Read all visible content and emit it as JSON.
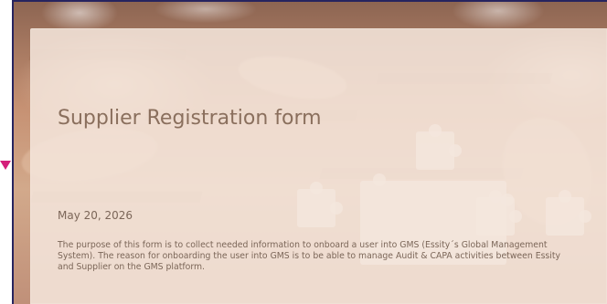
{
  "header": {
    "title": "Supplier Registration form"
  },
  "meta": {
    "date": "May 20, 2026"
  },
  "content": {
    "description": "The purpose of this form is to collect needed information to onboard a user into GMS (Essity´s Global Management System). The reason for onboarding the user into GMS is to be able to manage Audit & CAPA activities between Essity and Supplier on the GMS platform."
  },
  "theme": {
    "accent_border": "#27245f",
    "pointer_color": "#d41f7a",
    "title_color": "#8a6f5d",
    "text_color": "#7b6658",
    "overlay_color": "#f4e5db"
  },
  "decor": {
    "pointer_icon": "triangle-down-icon"
  }
}
